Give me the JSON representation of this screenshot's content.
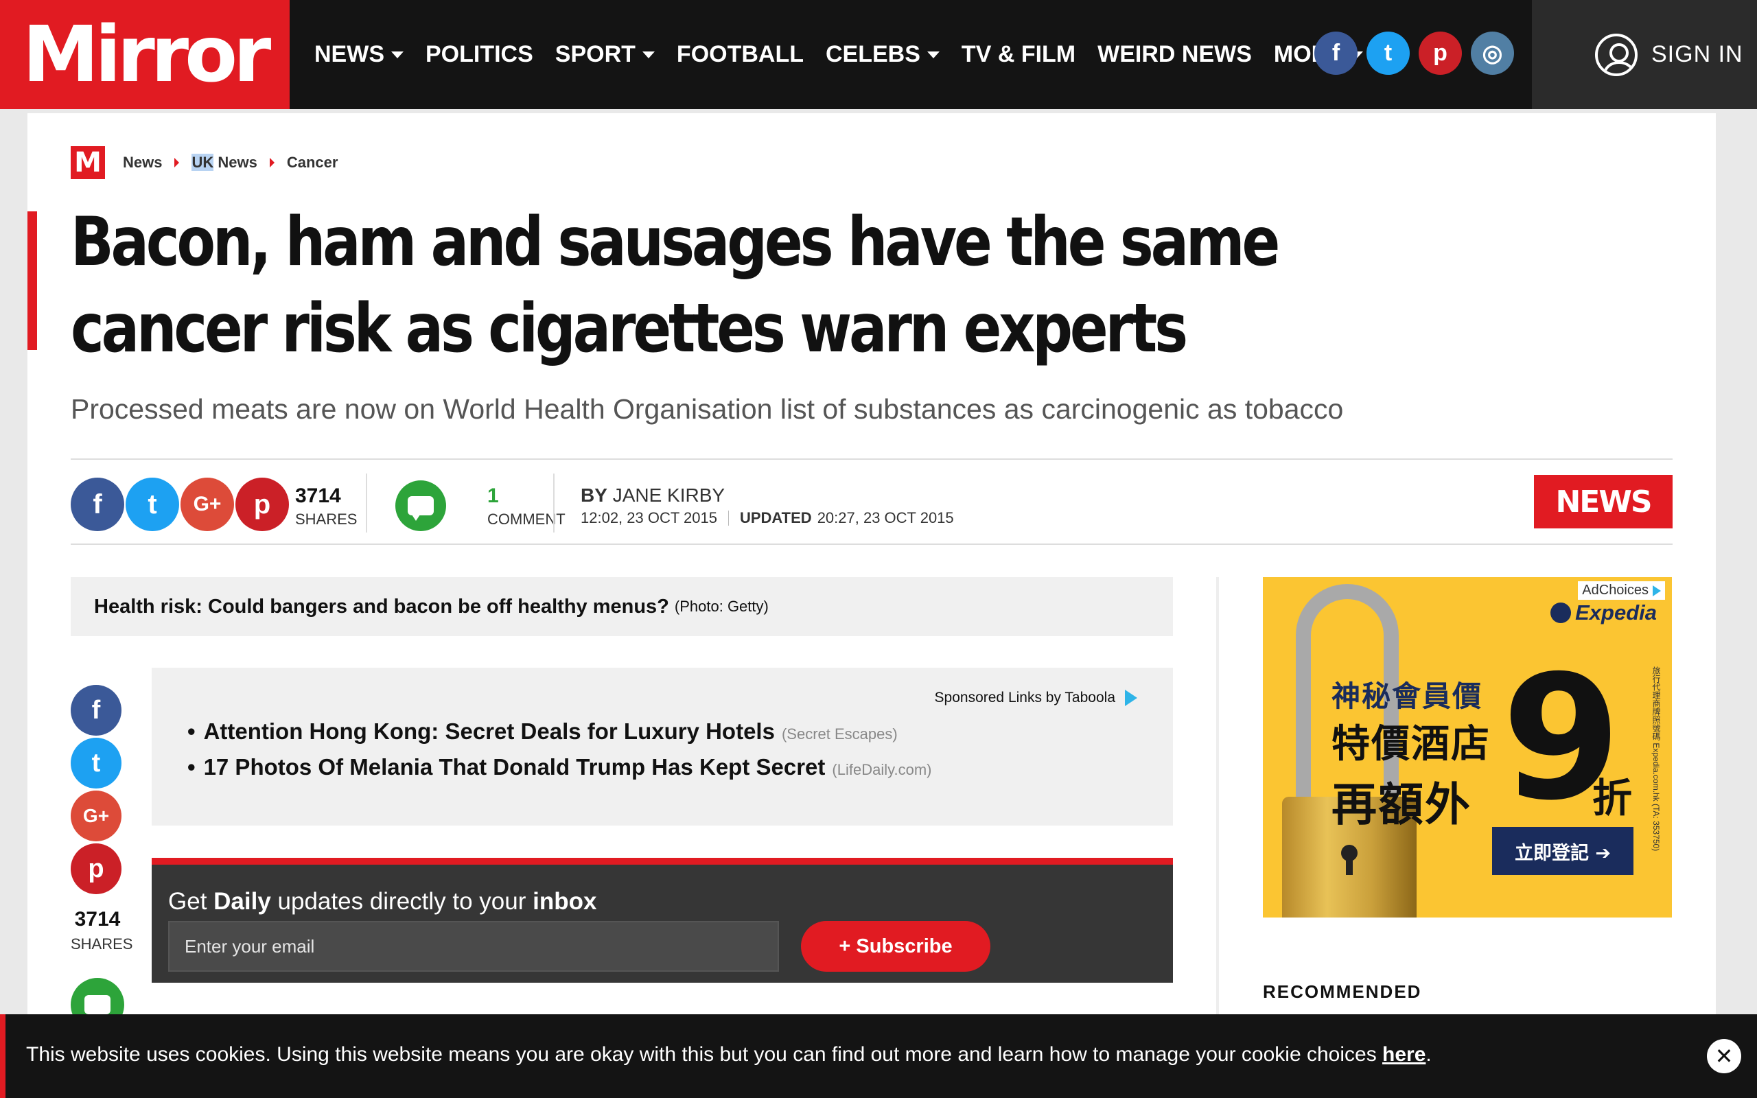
{
  "header": {
    "logo": "Mirror",
    "nav": [
      {
        "label": "NEWS",
        "dropdown": true
      },
      {
        "label": "POLITICS",
        "dropdown": false
      },
      {
        "label": "SPORT",
        "dropdown": true
      },
      {
        "label": "FOOTBALL",
        "dropdown": false
      },
      {
        "label": "CELEBS",
        "dropdown": true
      },
      {
        "label": "TV & FILM",
        "dropdown": false
      },
      {
        "label": "WEIRD NEWS",
        "dropdown": false
      },
      {
        "label": "MORE",
        "dropdown": true
      }
    ],
    "social": {
      "facebook": "f",
      "twitter": "t",
      "pinterest": "p",
      "instagram": "◎"
    },
    "signin_label": "SIGN IN"
  },
  "breadcrumb": {
    "badge": "M",
    "items": [
      {
        "label": "News"
      },
      {
        "highlight": "UK",
        "label": " News"
      },
      {
        "label": "Cancer"
      }
    ]
  },
  "article": {
    "headline": "Bacon, ham and sausages have the same cancer risk as cigarettes warn experts",
    "standfirst": "Processed meats are now on World Health Organisation list of substances as carcinogenic as tobacco",
    "share": {
      "google_plus": "G+",
      "count": "3714",
      "count_label": "SHARES"
    },
    "comments": {
      "count": "1",
      "label": "COMMENT"
    },
    "byline": {
      "prefix": "BY",
      "author": "JANE KIRBY"
    },
    "published": "12:02, 23 OCT 2015",
    "updated_label": "UPDATED",
    "updated": "20:27, 23 OCT 2015",
    "section_badge": "NEWS",
    "caption": {
      "text": "Health risk: Could bangers and bacon be off healthy menus?",
      "credit": "(Photo: Getty)"
    }
  },
  "sidebar_share": {
    "count": "3714",
    "label": "SHARES"
  },
  "taboola": {
    "header": "Sponsored Links by Taboola",
    "items": [
      {
        "bullet": "•",
        "title": "Attention Hong Kong: Secret Deals for Luxury Hotels",
        "source": "(Secret Escapes)"
      },
      {
        "bullet": "•",
        "title": "17 Photos Of Melania That Donald Trump Has Kept Secret",
        "source": "(LifeDaily.com)"
      }
    ]
  },
  "newsletter": {
    "heading_pre": "Get ",
    "heading_b1": "Daily",
    "heading_mid": " updates directly to your ",
    "heading_b2": "inbox",
    "placeholder": "Enter your email",
    "button": "+ Subscribe"
  },
  "ad": {
    "adchoices": "AdChoices",
    "brand": "Expedia",
    "line1": "神秘會員價",
    "line2": "特價酒店",
    "line3": "再額外",
    "big": "9",
    "small": "折",
    "cta": "立即登記 ➔",
    "fine": "旅行代理商牌照號碼 Expedia.com.hk (TA: 353750)"
  },
  "recommended": "RECOMMENDED",
  "cookie": {
    "text": "This website uses cookies. Using this website means you are okay with this but you can find out more and learn how to manage your cookie choices ",
    "link": "here",
    "end": ".",
    "close": "✕"
  },
  "colors": {
    "brand_red": "#e11b22",
    "facebook": "#3b5998",
    "twitter": "#1da1f2",
    "pinterest": "#cb2027",
    "google_plus": "#dd4b39",
    "comment_green": "#2da43a",
    "ad_yellow": "#fbc532"
  }
}
